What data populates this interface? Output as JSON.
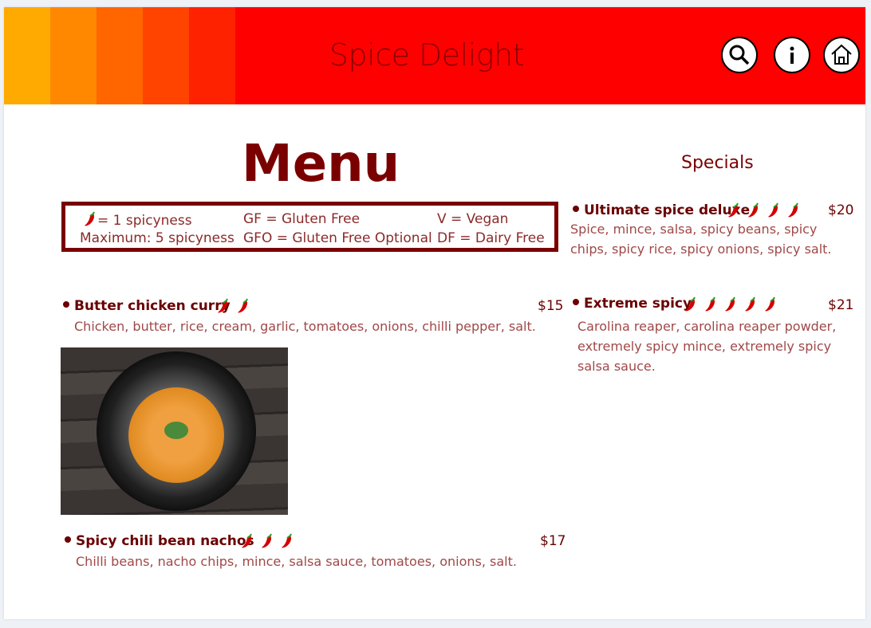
{
  "header": {
    "title": "Spice Delight",
    "stripes": [
      "#ffaa00",
      "#ff8800",
      "#ff6600",
      "#ff4400",
      "#ff2200"
    ],
    "buttons": [
      "search-icon",
      "info-icon",
      "home-icon"
    ]
  },
  "menu": {
    "heading": "Menu",
    "legend": {
      "chili": "= 1 spicyness",
      "max": "Maximum: 5 spicyness",
      "gf": "GF = Gluten Free",
      "gfo": "GFO = Gluten Free Optional",
      "v": "V = Vegan",
      "df": "DF = Dairy Free"
    },
    "items": [
      {
        "name": "Butter chicken curry",
        "spice": 2,
        "price": "$15",
        "desc": "Chicken, butter, rice, cream, garlic, tomatoes, onions, chilli pepper, salt."
      },
      {
        "name": "Spicy chili bean nachos",
        "spice": 3,
        "price": "$17",
        "desc": "Chilli beans, nacho chips, mince, salsa sauce, tomatoes, onions, salt."
      }
    ]
  },
  "specials": {
    "heading": "Specials",
    "items": [
      {
        "name": "Ultimate spice deluxe",
        "spice": 4,
        "price": "$20",
        "desc1": "Spice, mince, salsa, spicy beans, spicy",
        "desc2": "chips, spicy rice, spicy onions, spicy salt."
      },
      {
        "name": "Extreme spicy",
        "spice": 5,
        "price": "$21",
        "desc1": "Carolina reaper, carolina reaper powder,",
        "desc2": "extremely spicy mince, extremely spicy",
        "desc3": "salsa sauce."
      }
    ]
  }
}
